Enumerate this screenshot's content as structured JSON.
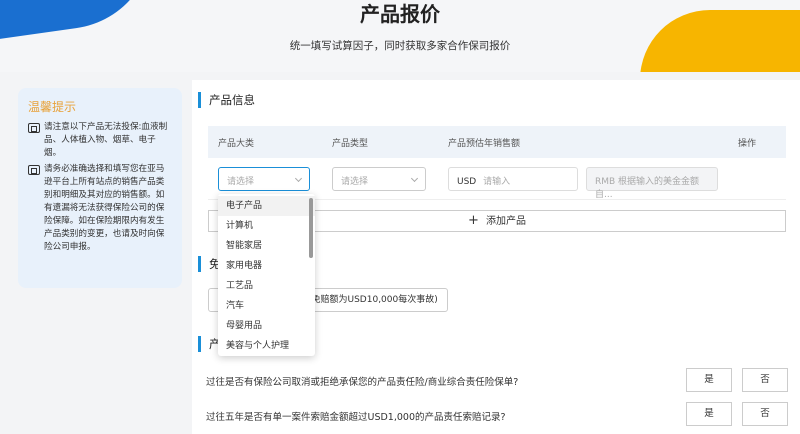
{
  "header": {
    "title": "产品报价",
    "subtitle": "统一填写试算因子，同时获取多家合作保司报价"
  },
  "tips": {
    "title": "温馨提示",
    "items": [
      "请注意以下产品无法投保:血液制品、人体植入物、烟草、电子烟。",
      "请务必准确选择和填写您在亚马逊平台上所有站点的销售产品类别和明细及其对应的销售额。如有遗漏将无法获得保险公司的保险保障。如在保险期限内有发生产品类别的变更，也请及时向保险公司申报。"
    ]
  },
  "product_info": {
    "title": "产品信息",
    "columns": [
      "产品大类",
      "产品类型",
      "产品预估年销售额",
      "操作"
    ],
    "category_placeholder": "请选择",
    "type_placeholder": "请选择",
    "usd_prefix": "USD",
    "usd_placeholder": "请输入",
    "rmb_placeholder": "RMB 根据输入的美金金额自...",
    "add_label": "添加产品"
  },
  "deductible": {
    "title_visible": "免",
    "value_visible": "额(免赔额为USD10,000每次事故)"
  },
  "history": {
    "title_visible": "产",
    "questions": [
      {
        "text": "过往是否有保险公司取消或拒绝承保您的产品责任险/商业综合责任险保单?",
        "yes": "是",
        "no": "否"
      },
      {
        "text": "过往五年是否有单一案件索赔金额超过USD1,000的产品责任索赔记录?",
        "yes": "是",
        "no": "否"
      }
    ]
  },
  "dropdown": {
    "options": [
      "电子产品",
      "计算机",
      "智能家居",
      "家用电器",
      "工艺品",
      "汽车",
      "母婴用品",
      "美容与个人护理"
    ]
  }
}
